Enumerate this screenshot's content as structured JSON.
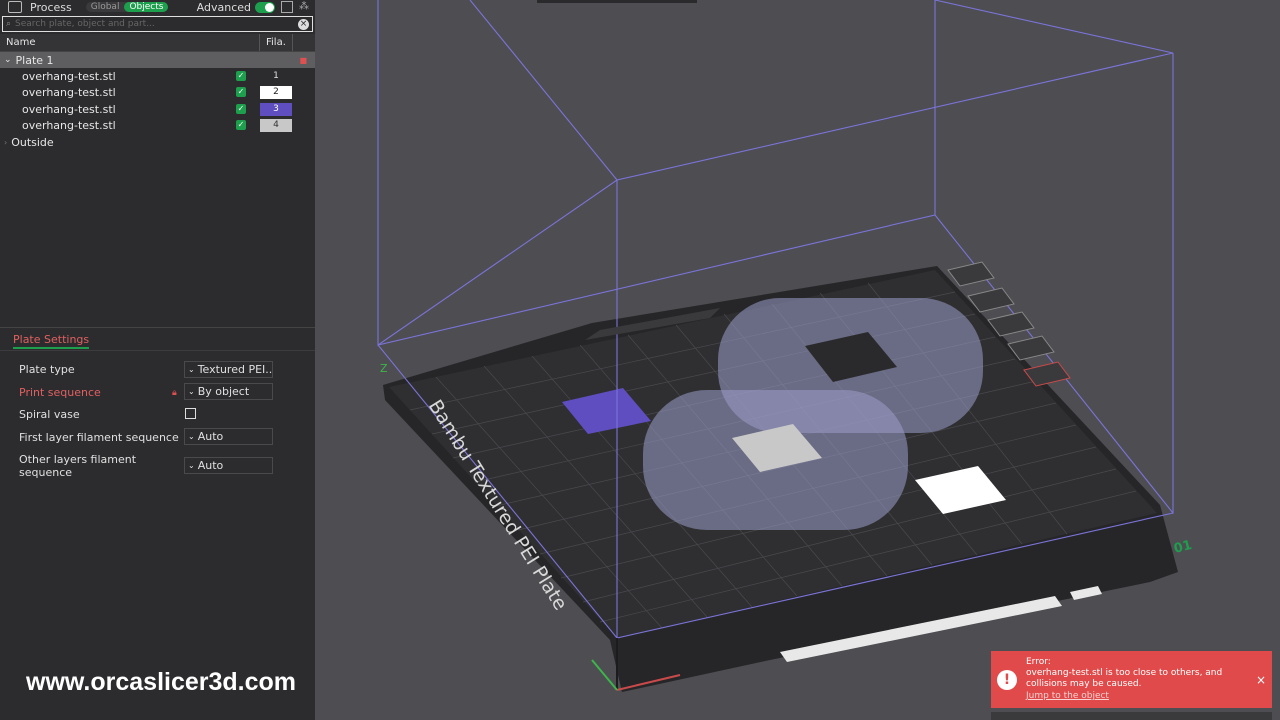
{
  "topbar": {
    "process_label": "Process",
    "global_label": "Global",
    "objects_label": "Objects",
    "advanced_label": "Advanced"
  },
  "search": {
    "placeholder": "Search plate, object and part..."
  },
  "tree": {
    "col_name": "Name",
    "col_fila": "Fila.",
    "plate_label": "Plate 1",
    "objects": [
      {
        "name": "overhang-test.stl",
        "filament": "1",
        "color": "#2c2c2f",
        "text_color": "#e0e0e0"
      },
      {
        "name": "overhang-test.stl",
        "filament": "2",
        "color": "#ffffff",
        "text_color": "#222222"
      },
      {
        "name": "overhang-test.stl",
        "filament": "3",
        "color": "#5f4ec0",
        "text_color": "#ffffff"
      },
      {
        "name": "overhang-test.stl",
        "filament": "4",
        "color": "#c8c8c8",
        "text_color": "#333333"
      }
    ],
    "outside_label": "Outside"
  },
  "plate_settings": {
    "tab_label": "Plate Settings",
    "plate_type_label": "Plate type",
    "plate_type_value": "Textured PEI...",
    "print_sequence_label": "Print sequence",
    "print_sequence_value": "By object",
    "spiral_vase_label": "Spiral vase",
    "first_layer_label": "First layer filament sequence",
    "first_layer_value": "Auto",
    "other_layers_label_1": "Other layers filament",
    "other_layers_label_2": "sequence",
    "other_layers_value": "Auto"
  },
  "viewport": {
    "plate_text": "Bambu Textured PEI Plate",
    "plate_number": "01",
    "axis_z": "Z"
  },
  "error": {
    "title": "Error:",
    "message": "overhang-test.stl is too close to others, and collisions may be caused.",
    "link": "Jump to the object"
  },
  "watermark": "www.orcaslicer3d.com",
  "colors": {
    "accent": "#1d9f4d",
    "error": "#e04a4a",
    "filament3": "#5f4ec0"
  }
}
